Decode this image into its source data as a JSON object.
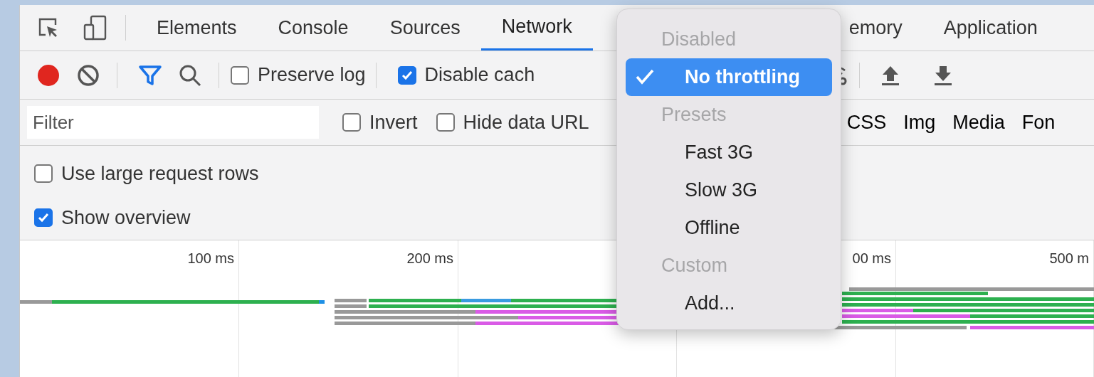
{
  "tabs": [
    {
      "label": "Elements",
      "selected": false
    },
    {
      "label": "Console",
      "selected": false
    },
    {
      "label": "Sources",
      "selected": false
    },
    {
      "label": "Network",
      "selected": true
    },
    {
      "label": "emory",
      "selected": false
    },
    {
      "label": "Application",
      "selected": false
    }
  ],
  "toolbar": {
    "recording": true,
    "preserve_log": {
      "label": "Preserve log",
      "checked": false
    },
    "disable_cache": {
      "label": "Disable cach",
      "checked": true
    }
  },
  "filter": {
    "placeholder": "Filter",
    "invert": {
      "label": "Invert",
      "checked": false
    },
    "hide_data_urls": {
      "label": "Hide data URL",
      "checked": false
    },
    "types": [
      {
        "label": "CSS"
      },
      {
        "label": "Img"
      },
      {
        "label": "Media"
      },
      {
        "label": "Fon"
      }
    ]
  },
  "options": [
    {
      "label": "Use large request rows",
      "checked": false
    },
    {
      "label": "Show overview",
      "checked": true
    }
  ],
  "timeline": {
    "ticks": [
      "100 ms",
      "200 ms",
      "00 ms",
      "500 m"
    ]
  },
  "throttling_menu": {
    "items": [
      {
        "kind": "header",
        "label": "Disabled"
      },
      {
        "kind": "option",
        "label": "No throttling",
        "selected": true
      },
      {
        "kind": "header",
        "label": "Presets"
      },
      {
        "kind": "option",
        "label": "Fast 3G",
        "selected": false
      },
      {
        "kind": "option",
        "label": "Slow 3G",
        "selected": false
      },
      {
        "kind": "option",
        "label": "Offline",
        "selected": false
      },
      {
        "kind": "header",
        "label": "Custom"
      },
      {
        "kind": "option",
        "label": "Add...",
        "selected": false
      }
    ]
  }
}
